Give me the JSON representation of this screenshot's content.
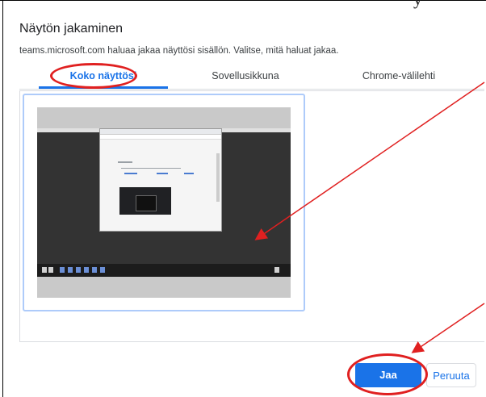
{
  "dialog": {
    "title": "Näytön jakaminen",
    "subtitle": "teams.microsoft.com haluaa jakaa näyttösi sisällön. Valitse, mitä haluat jakaa.",
    "top_right_text": "y"
  },
  "tabs": [
    {
      "label": "Koko näyttösi",
      "active": true
    },
    {
      "label": "Sovellusikkuna",
      "active": false
    },
    {
      "label": "Chrome-välilehti",
      "active": false
    }
  ],
  "buttons": {
    "share": "Jaa",
    "cancel": "Peruuta"
  },
  "colors": {
    "accent": "#1a73e8",
    "annotation": "#e02020"
  },
  "icons": [
    "screen-thumbnail-icon"
  ]
}
